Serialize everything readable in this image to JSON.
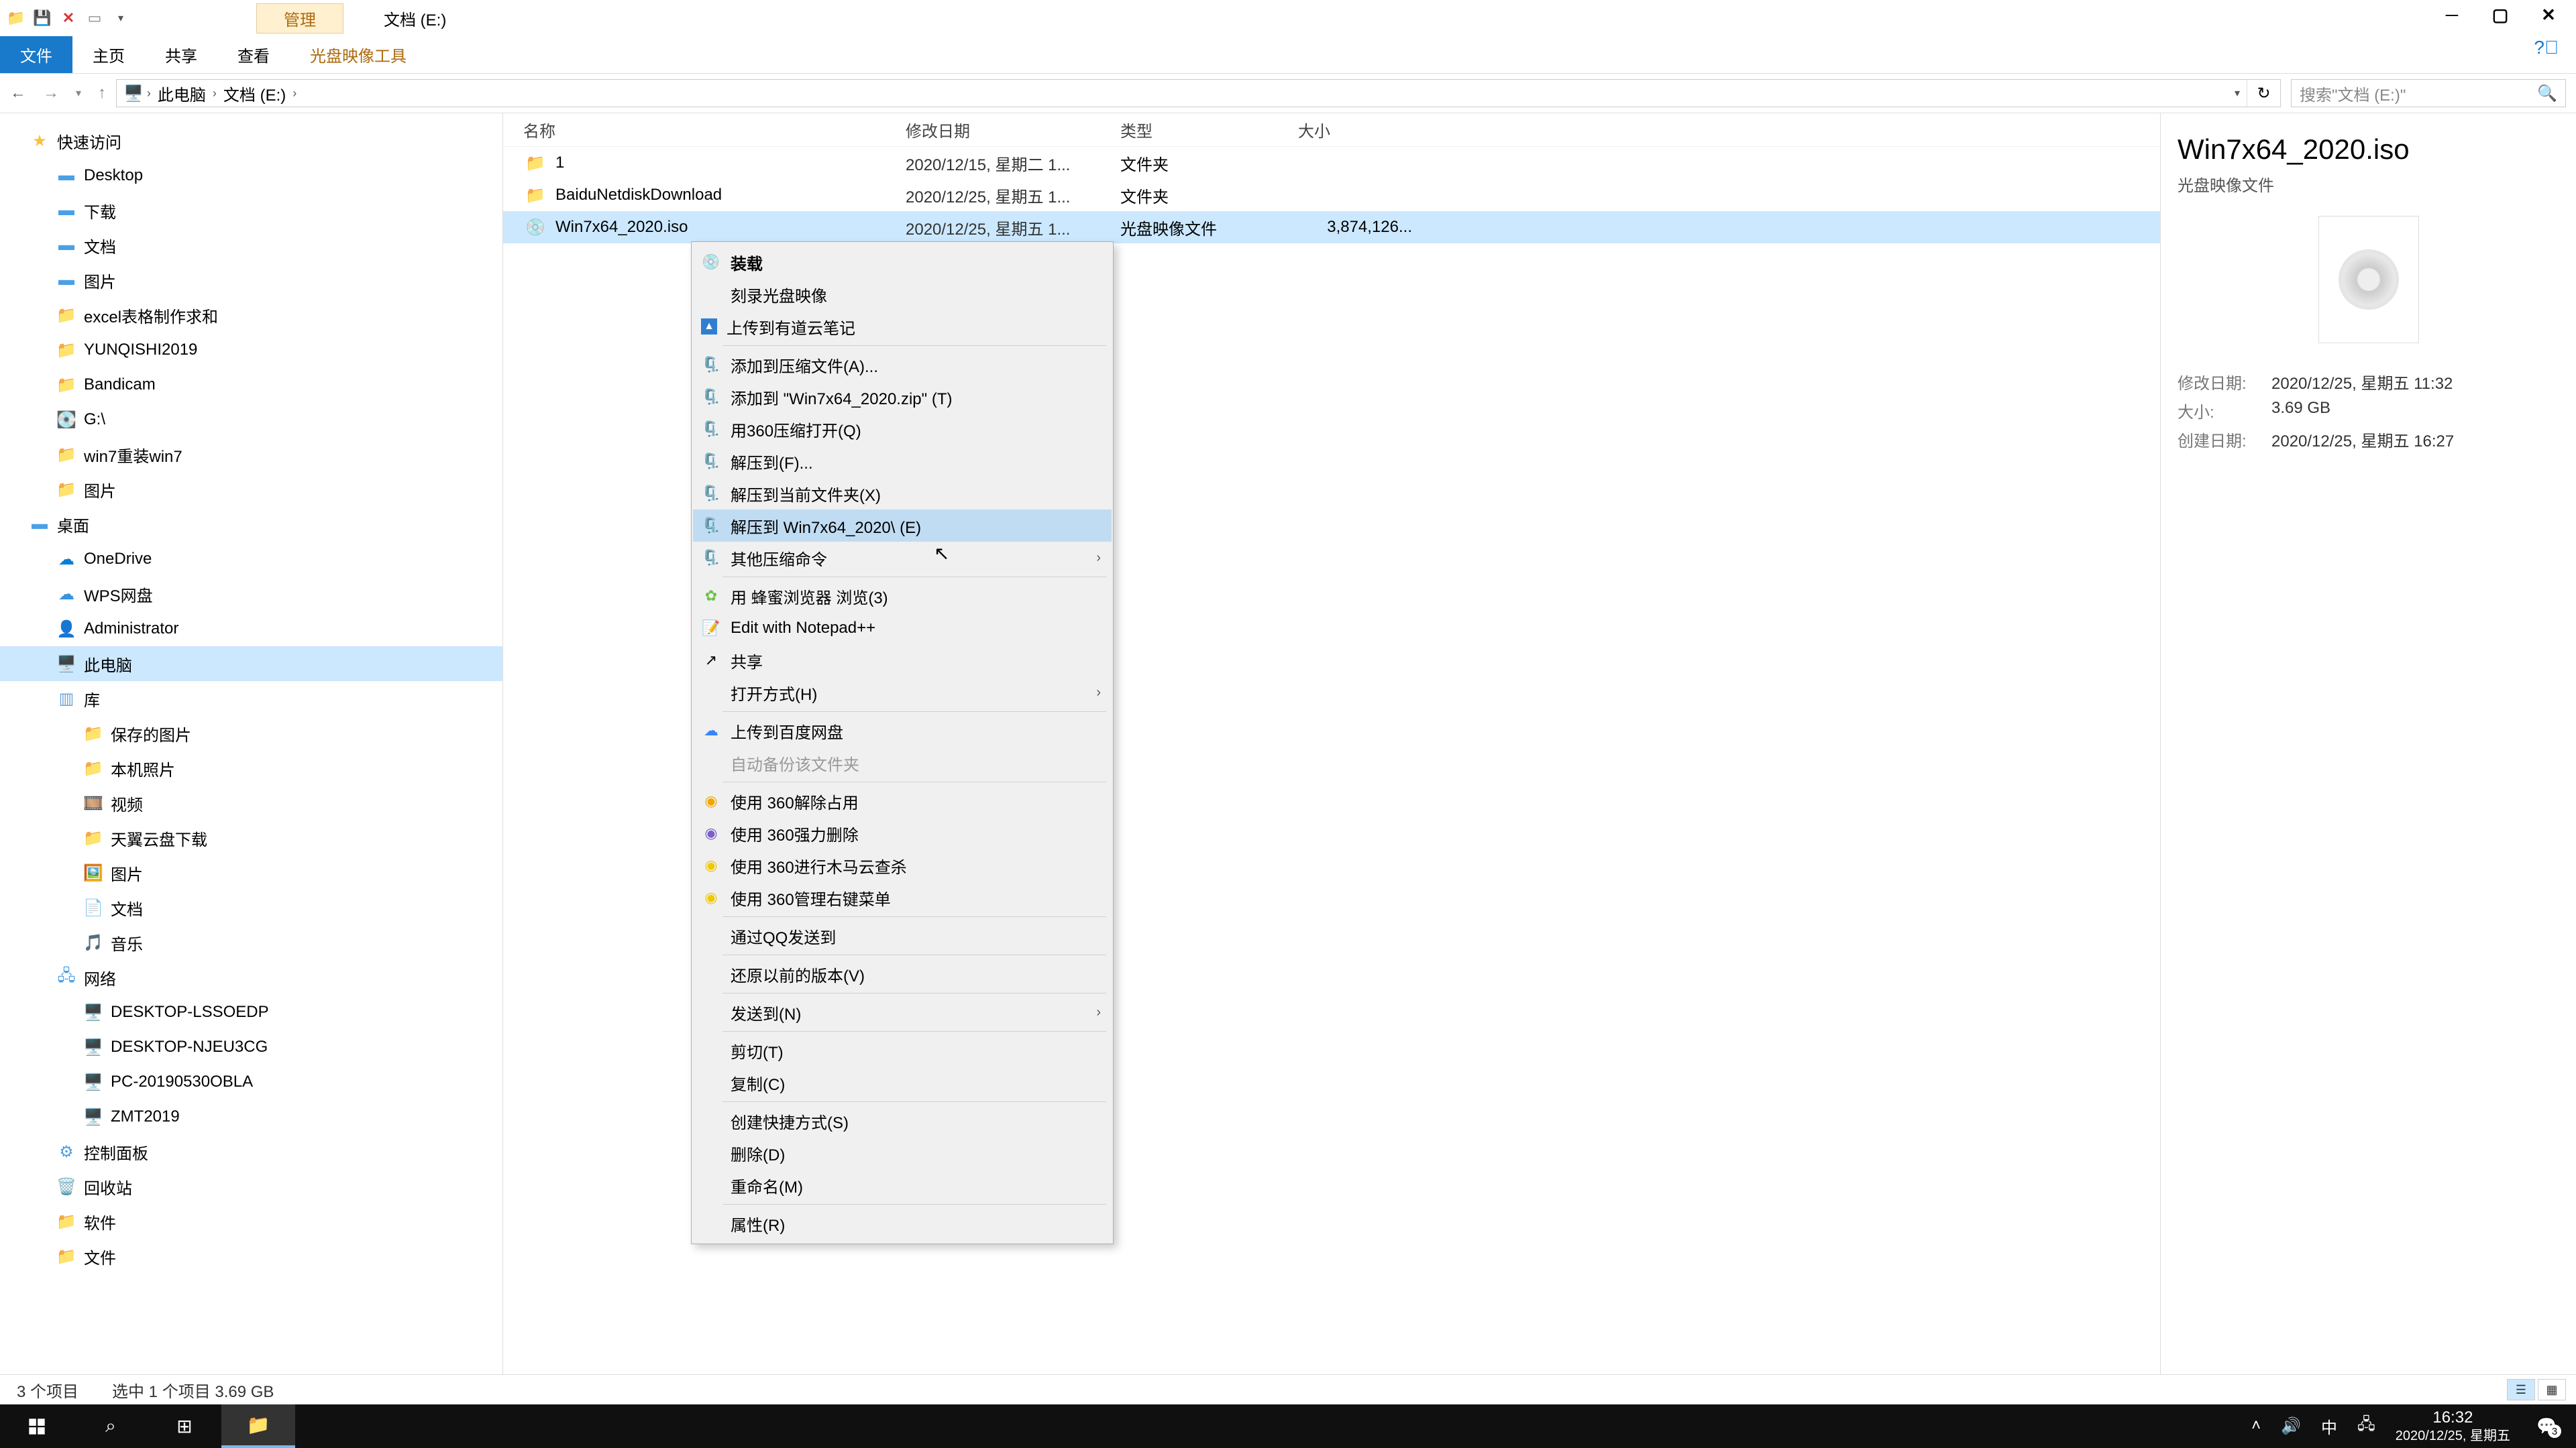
{
  "titlebar": {
    "manage_tab": "管理",
    "location_tab": "文档 (E:)"
  },
  "ribbon": {
    "file": "文件",
    "home": "主页",
    "share": "共享",
    "view": "查看",
    "image_tools": "光盘映像工具"
  },
  "address": {
    "this_pc": "此电脑",
    "drive": "文档 (E:)"
  },
  "search": {
    "placeholder": "搜索\"文档 (E:)\""
  },
  "tree": {
    "quick_access": "快速访问",
    "desktop": "Desktop",
    "downloads": "下载",
    "documents": "文档",
    "pictures": "图片",
    "excel": "excel表格制作求和",
    "yunqishi": "YUNQISHI2019",
    "bandicam": "Bandicam",
    "drive_g": "G:\\",
    "win7reinstall": "win7重装win7",
    "pictures2": "图片",
    "desktop_group": "桌面",
    "onedrive": "OneDrive",
    "wps": "WPS网盘",
    "administrator": "Administrator",
    "this_pc": "此电脑",
    "libraries": "库",
    "saved_pictures": "保存的图片",
    "local_photos": "本机照片",
    "videos": "视频",
    "tianyi": "天翼云盘下载",
    "pictures3": "图片",
    "documents2": "文档",
    "music": "音乐",
    "network": "网络",
    "pc1": "DESKTOP-LSSOEDP",
    "pc2": "DESKTOP-NJEU3CG",
    "pc3": "PC-20190530OBLA",
    "pc4": "ZMT2019",
    "control_panel": "控制面板",
    "recycle": "回收站",
    "software": "软件",
    "files": "文件"
  },
  "columns": {
    "name": "名称",
    "date": "修改日期",
    "type": "类型",
    "size": "大小"
  },
  "rows": [
    {
      "name": "1",
      "date": "2020/12/15, 星期二 1...",
      "type": "文件夹",
      "size": ""
    },
    {
      "name": "BaiduNetdiskDownload",
      "date": "2020/12/25, 星期五 1...",
      "type": "文件夹",
      "size": ""
    },
    {
      "name": "Win7x64_2020.iso",
      "date": "2020/12/25, 星期五 1...",
      "type": "光盘映像文件",
      "size": "3,874,126..."
    }
  ],
  "context": {
    "mount": "装载",
    "burn": "刻录光盘映像",
    "youdao": "上传到有道云笔记",
    "add_archive": "添加到压缩文件(A)...",
    "add_zip": "添加到 \"Win7x64_2020.zip\" (T)",
    "open_360": "用360压缩打开(Q)",
    "extract_to": "解压到(F)...",
    "extract_here": "解压到当前文件夹(X)",
    "extract_named": "解压到 Win7x64_2020\\ (E)",
    "other_compress": "其他压缩命令",
    "bee_browser": "用 蜂蜜浏览器 浏览(3)",
    "notepad": "Edit with Notepad++",
    "share": "共享",
    "open_with": "打开方式(H)",
    "baidu_upload": "上传到百度网盘",
    "auto_backup": "自动备份该文件夹",
    "unlock_360": "使用 360解除占用",
    "force_del_360": "使用 360强力删除",
    "trojan_360": "使用 360进行木马云查杀",
    "manage_360": "使用 360管理右键菜单",
    "qq_send": "通过QQ发送到",
    "restore": "还原以前的版本(V)",
    "send_to": "发送到(N)",
    "cut": "剪切(T)",
    "copy": "复制(C)",
    "shortcut": "创建快捷方式(S)",
    "delete": "删除(D)",
    "rename": "重命名(M)",
    "properties": "属性(R)"
  },
  "details": {
    "title": "Win7x64_2020.iso",
    "subtitle": "光盘映像文件",
    "mod_k": "修改日期:",
    "mod_v": "2020/12/25, 星期五 11:32",
    "size_k": "大小:",
    "size_v": "3.69 GB",
    "create_k": "创建日期:",
    "create_v": "2020/12/25, 星期五 16:27"
  },
  "status": {
    "items": "3 个项目",
    "selected": "选中 1 个项目  3.69 GB"
  },
  "taskbar": {
    "ime": "中",
    "time": "16:32",
    "date": "2020/12/25, 星期五",
    "badge": "3"
  }
}
